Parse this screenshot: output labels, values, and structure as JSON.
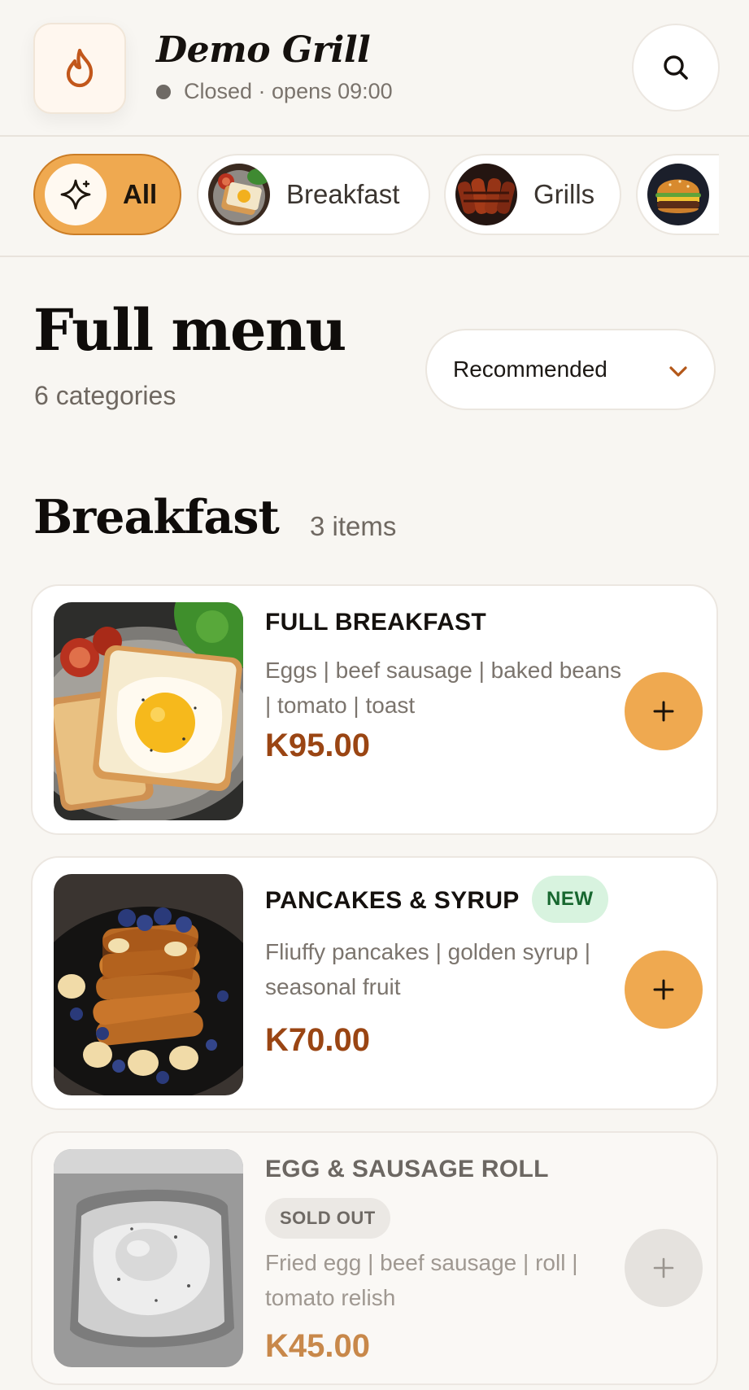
{
  "header": {
    "logo_icon": "flame-icon",
    "title": "Demo Grill",
    "status": "Closed · opens 09:00",
    "search_icon": "search-icon"
  },
  "categories": [
    {
      "label": "All",
      "icon": "sparkle-icon",
      "active": true
    },
    {
      "label": "Breakfast",
      "icon": "breakfast-thumb",
      "active": false
    },
    {
      "label": "Grills",
      "icon": "grills-thumb",
      "active": false
    },
    {
      "label": "",
      "icon": "burger-thumb",
      "active": false
    }
  ],
  "menu": {
    "title": "Full menu",
    "subtitle": "6 categories",
    "sort": {
      "label": "Recommended",
      "icon": "chevron-down-icon"
    }
  },
  "section": {
    "title": "Breakfast",
    "count": "3 items",
    "items": [
      {
        "name": "FULL BREAKFAST",
        "description": "Eggs | beef sausage | baked beans | tomato | toast",
        "price": "K95.00",
        "badge": "",
        "available": true
      },
      {
        "name": "PANCAKES & SYRUP",
        "description": "Fliuffy pancakes | golden syrup | seasonal fruit",
        "price": "K70.00",
        "badge": "NEW",
        "available": true
      },
      {
        "name": "EGG & SAUSAGE ROLL",
        "description": "Fried egg | beef sausage | roll | tomato relish",
        "price": "K45.00",
        "badge": "SOLD OUT",
        "available": false
      }
    ]
  },
  "colors": {
    "accent": "#efa950",
    "price": "#9a4513",
    "background": "#f8f6f2",
    "new_badge": "#d8f3df",
    "sold_out_badge": "#ebe8e4"
  }
}
